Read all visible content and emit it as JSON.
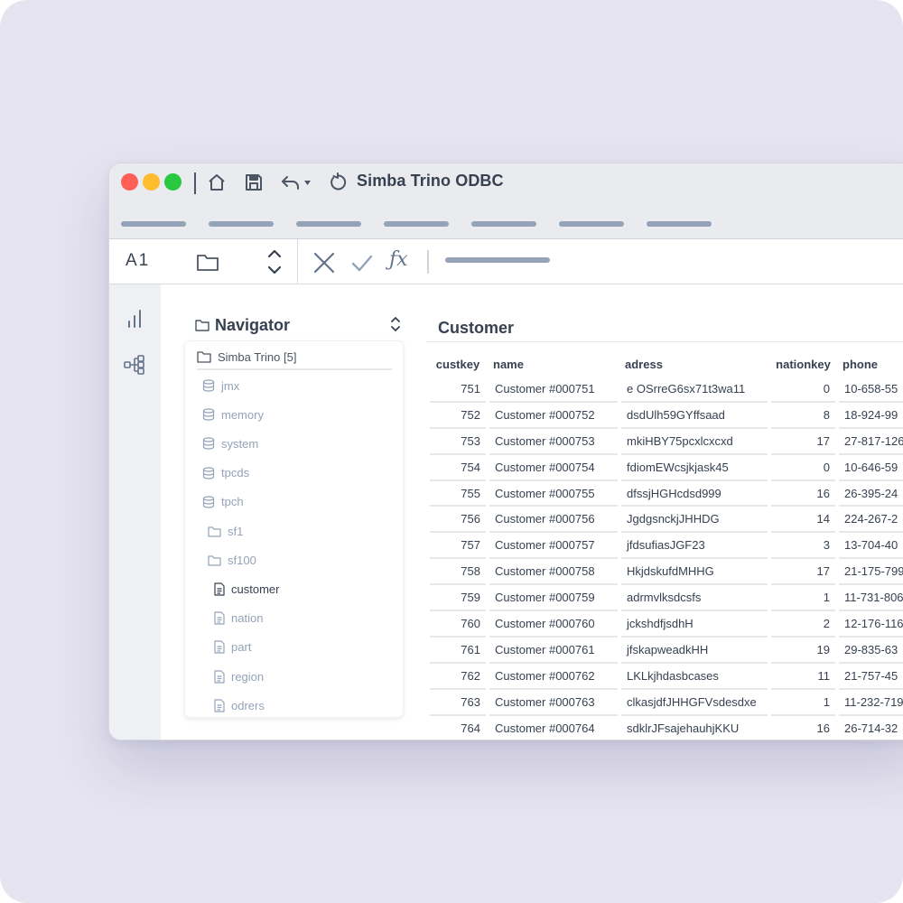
{
  "window": {
    "title": "Simba Trino ODBC"
  },
  "formula_bar": {
    "cell_ref": "A1",
    "fx_label": "ƒx"
  },
  "navigator": {
    "title": "Navigator",
    "root_label": "Simba Trino [5]",
    "items": [
      {
        "label": "jmx",
        "icon": "database-icon",
        "level": 0,
        "active": false
      },
      {
        "label": "memory",
        "icon": "database-icon",
        "level": 0,
        "active": false
      },
      {
        "label": "system",
        "icon": "database-icon",
        "level": 0,
        "active": false
      },
      {
        "label": "tpcds",
        "icon": "database-icon",
        "level": 0,
        "active": false
      },
      {
        "label": "tpch",
        "icon": "database-icon",
        "level": 0,
        "active": false
      },
      {
        "label": "sf1",
        "icon": "folder-icon",
        "level": 1,
        "active": false
      },
      {
        "label": "sf100",
        "icon": "folder-icon",
        "level": 1,
        "active": false
      },
      {
        "label": "customer",
        "icon": "file-icon",
        "level": 2,
        "active": true
      },
      {
        "label": "nation",
        "icon": "file-icon",
        "level": 2,
        "active": false
      },
      {
        "label": "part",
        "icon": "file-icon",
        "level": 2,
        "active": false
      },
      {
        "label": "region",
        "icon": "file-icon",
        "level": 2,
        "active": false
      },
      {
        "label": "odrers",
        "icon": "file-icon",
        "level": 2,
        "active": false
      }
    ]
  },
  "grid": {
    "title": "Customer",
    "columns": [
      "custkey",
      "name",
      "adress",
      "nationkey",
      "phone"
    ],
    "rows": [
      [
        "751",
        "Customer #000751",
        "e OSrreG6sx71t3wa11",
        "0",
        "10-658-55"
      ],
      [
        "752",
        "Customer #000752",
        "dsdUlh59GYffsaad",
        "8",
        "18-924-99"
      ],
      [
        "753",
        "Customer #000753",
        "mkiHBY75pcxlcxcxd",
        "17",
        "27-817-126"
      ],
      [
        "754",
        "Customer #000754",
        "fdiomEWcsjkjask45",
        "0",
        "10-646-59"
      ],
      [
        "755",
        "Customer #000755",
        "dfssjHGHcdsd999",
        "16",
        "26-395-24"
      ],
      [
        "756",
        "Customer #000756",
        "JgdgsnckjJHHDG",
        "14",
        "224-267-2"
      ],
      [
        "757",
        "Customer #000757",
        "jfdsufiasJGF23",
        "3",
        "13-704-40"
      ],
      [
        "758",
        "Customer #000758",
        "HkjdskufdMHHG",
        "17",
        "21-175-799"
      ],
      [
        "759",
        "Customer #000759",
        "adrmvlksdcsfs",
        "1",
        "11-731-806"
      ],
      [
        "760",
        "Customer #000760",
        "jckshdfjsdhH",
        "2",
        "12-176-116"
      ],
      [
        "761",
        "Customer #000761",
        "jfskapweadkHH",
        "19",
        "29-835-63"
      ],
      [
        "762",
        "Customer #000762",
        "LKLkjhdasbcases",
        "11",
        "21-757-45"
      ],
      [
        "763",
        "Customer #000763",
        "clkasjdfJHHGFVsdesdxe",
        "1",
        "11-232-719"
      ],
      [
        "764",
        "Customer #000764",
        "sdklrJFsajehauhjKKU",
        "16",
        "26-714-32"
      ]
    ]
  },
  "colors": {
    "background": "#e6e4f1",
    "close": "#ff5f57",
    "minimize": "#febc2e",
    "maximize": "#28c840",
    "muted": "#94a3b8",
    "text": "#374151"
  }
}
